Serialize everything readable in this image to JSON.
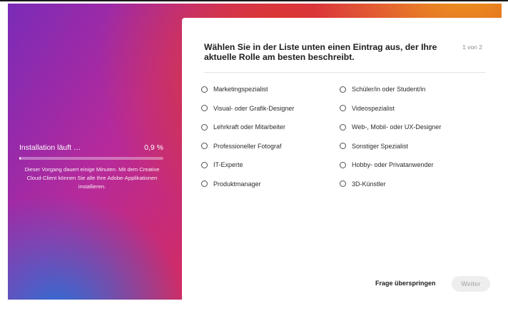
{
  "installer": {
    "status_label": "Installation läuft …",
    "progress_percent_text": "0,9 %",
    "progress_fraction": 0.009,
    "description": "Dieser Vorgang dauert einige Minuten. Mit dem Creative Cloud-Client können Sie alle Ihre Adobe-Applikationen installieren."
  },
  "survey": {
    "question": "Wählen Sie in der Liste unten einen Eintrag aus, der Ihre aktuelle Rolle am besten beschreibt.",
    "step": "1 von 2",
    "options": [
      "Marketingspezialist",
      "Schüler/in oder Student/in",
      "Visual- oder Grafik-Designer",
      "Videospezialist",
      "Lehrkraft oder Mitarbeiter",
      "Web-, Mobil- oder UX-Designer",
      "Professioneller Fotograf",
      "Sonstiger Spezialist",
      "IT-Experte",
      "Hobby- oder Privatanwender",
      "Produktmanager",
      "3D-Künstler"
    ],
    "skip_label": "Frage überspringen",
    "next_label": "Weiter"
  },
  "colors": {
    "gradient": [
      "#7a2bb8",
      "#d62c5a",
      "#e23b1e",
      "#f0a21a",
      "#2a6fd6"
    ],
    "next_button_disabled_bg": "#eeeeee",
    "next_button_disabled_text": "#b8b8b8"
  }
}
